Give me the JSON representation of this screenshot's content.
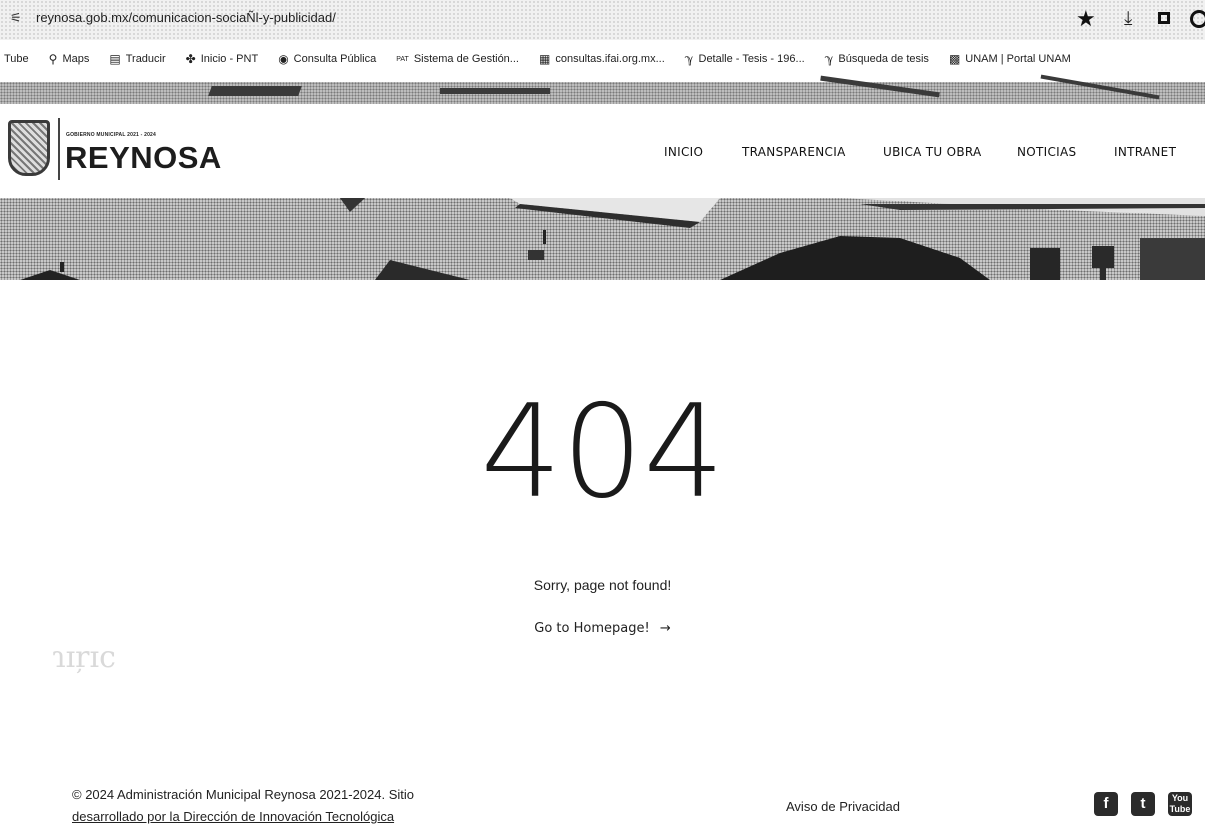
{
  "browser": {
    "url": "reynosa.gob.mx/comunicacion-sociaÑl-y-publicidad/",
    "site_info_icon": "tune-icon",
    "bookmarks": [
      {
        "label": "Tube",
        "icon": ""
      },
      {
        "label": "Maps",
        "icon": "map-pin-icon"
      },
      {
        "label": "Traducir",
        "icon": "translate-icon"
      },
      {
        "label": "Inicio - PNT",
        "icon": "pnt-icon"
      },
      {
        "label": "Consulta Pública",
        "icon": "globe-icon"
      },
      {
        "label": "Sistema de Gestión...",
        "icon": "pat-icon"
      },
      {
        "label": "consultas.ifai.org.mx...",
        "icon": "document-icon"
      },
      {
        "label": "Detalle - Tesis - 196...",
        "icon": "scjn-icon"
      },
      {
        "label": "Búsqueda de tesis",
        "icon": "scjn-icon"
      },
      {
        "label": "UNAM | Portal UNAM",
        "icon": "unam-icon"
      }
    ]
  },
  "header": {
    "logo_subtitle": "GOBIERNO MUNICIPAL 2021 - 2024",
    "logo_name": "REYNOSA",
    "nav": [
      "INICIO",
      "TRANSPARENCIA",
      "UBICA TU OBRA",
      "NOTICIAS",
      "INTRANET"
    ]
  },
  "main": {
    "code": "404",
    "message": "Sorry, page not found!",
    "home_link": "Go to Homepage!",
    "home_arrow": "→"
  },
  "footer": {
    "copyright_line1": "© 2024 Administración Municipal Reynosa 2021-2024. Sitio",
    "copyright_line2": "desarrollado por la Dirección de Innovación Tecnológica",
    "privacy": "Aviso de Privacidad",
    "social": [
      "facebook-icon",
      "twitter-icon",
      "youtube-icon"
    ]
  }
}
